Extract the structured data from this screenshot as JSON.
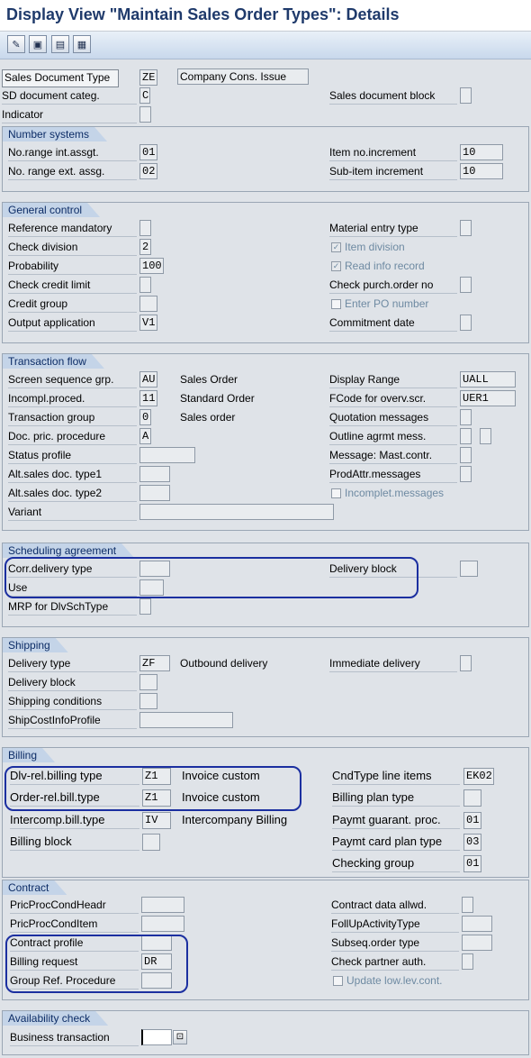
{
  "title": "Display View \"Maintain Sales Order Types\": Details",
  "toolbar": {
    "icons": [
      "edit-icon",
      "save-icon",
      "next-entry-icon",
      "select-icon"
    ]
  },
  "header": {
    "doc_type_label": "Sales Document Type",
    "doc_type_value": "ZE",
    "doc_type_desc": "Company Cons. Issue",
    "sd_categ_label": "SD document categ.",
    "sd_categ_value": "C",
    "sales_block_label": "Sales document block",
    "indicator_label": "Indicator"
  },
  "number_systems": {
    "title": "Number systems",
    "int_label": "No.range int.assgt.",
    "int_value": "01",
    "ext_label": "No. range ext. assg.",
    "ext_value": "02",
    "item_inc_label": "Item no.increment",
    "item_inc_value": "10",
    "sub_inc_label": "Sub-item increment",
    "sub_inc_value": "10"
  },
  "general_control": {
    "title": "General control",
    "ref_mand_label": "Reference mandatory",
    "check_div_label": "Check division",
    "check_div_value": "2",
    "prob_label": "Probability",
    "prob_value": "100",
    "credit_limit_label": "Check credit limit",
    "credit_group_label": "Credit group",
    "output_app_label": "Output application",
    "output_app_value": "V1",
    "mat_entry_label": "Material entry type",
    "item_div_label": "Item division",
    "read_info_label": "Read info record",
    "purch_order_label": "Check purch.order no",
    "enter_po_label": "Enter PO number",
    "commit_date_label": "Commitment  date"
  },
  "transaction_flow": {
    "title": "Transaction flow",
    "screen_seq_label": "Screen sequence grp.",
    "screen_seq_value": "AU",
    "screen_seq_desc": "Sales Order",
    "incomp_label": "Incompl.proced.",
    "incomp_value": "11",
    "incomp_desc": "Standard Order",
    "trans_group_label": "Transaction group",
    "trans_group_value": "0",
    "trans_group_desc": "Sales order",
    "doc_pric_label": "Doc. pric. procedure",
    "doc_pric_value": "A",
    "status_profile_label": "Status profile",
    "alt1_label": "Alt.sales doc. type1",
    "alt2_label": "Alt.sales doc. type2",
    "variant_label": "Variant",
    "display_range_label": "Display Range",
    "display_range_value": "UALL",
    "fcode_label": "FCode for overv.scr.",
    "fcode_value": "UER1",
    "quotation_label": "Quotation messages",
    "outline_label": "Outline agrmt mess.",
    "mast_contr_label": "Message: Mast.contr.",
    "prodattr_label": "ProdAttr.messages",
    "incomplet_label": "Incomplet.messages"
  },
  "scheduling": {
    "title": "Scheduling agreement",
    "corr_label": "Corr.delivery type",
    "use_label": "Use",
    "mrp_label": "MRP for DlvSchType",
    "del_block_label": "Delivery block"
  },
  "shipping": {
    "title": "Shipping",
    "del_type_label": "Delivery type",
    "del_type_value": "ZF",
    "del_type_desc": "Outbound delivery",
    "del_block_label": "Delivery block",
    "ship_cond_label": "Shipping conditions",
    "shipcost_label": "ShipCostInfoProfile",
    "immediate_label": "Immediate delivery"
  },
  "billing": {
    "title": "Billing",
    "dlv_label": "Dlv-rel.billing type",
    "dlv_value": "Z1",
    "dlv_desc": "Invoice custom",
    "order_label": "Order-rel.bill.type",
    "order_value": "Z1",
    "order_desc": "Invoice custom",
    "intercomp_label": "Intercomp.bill.type",
    "intercomp_value": "IV",
    "intercomp_desc": "Intercompany Billing",
    "block_label": "Billing block",
    "cndtype_label": "CndType line items",
    "cndtype_value": "EK02",
    "plan_label": "Billing plan type",
    "paymt_guar_label": "Paymt guarant. proc.",
    "paymt_guar_value": "01",
    "paymt_card_label": "Paymt card plan type",
    "paymt_card_value": "03",
    "checking_label": "Checking group",
    "checking_value": "01"
  },
  "contract": {
    "title": "Contract",
    "pric_head_label": "PricProcCondHeadr",
    "pric_item_label": "PricProcCondItem",
    "profile_label": "Contract profile",
    "billing_req_label": "Billing request",
    "billing_req_value": "DR",
    "group_ref_label": "Group Ref. Procedure",
    "data_allwd_label": "Contract data allwd.",
    "follup_label": "FollUpActivityType",
    "subseq_label": "Subseq.order type",
    "check_partner_label": "Check partner auth.",
    "update_label": "Update low.lev.cont."
  },
  "availability": {
    "title": "Availability check",
    "business_label": "Business transaction"
  }
}
